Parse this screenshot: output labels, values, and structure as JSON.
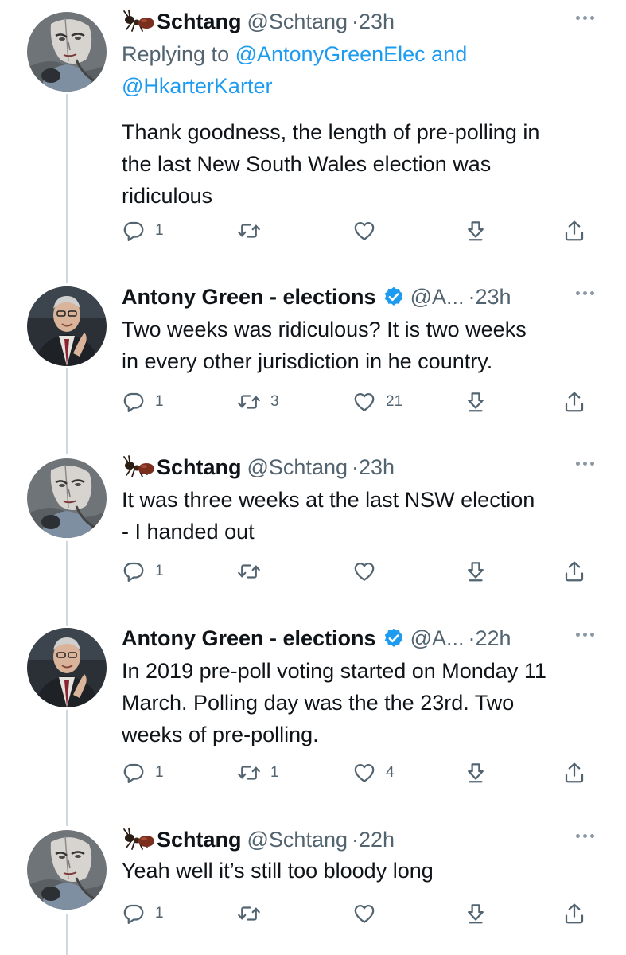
{
  "tweets": [
    {
      "author": "Schtang",
      "handle": "@Schtang",
      "time": "23h",
      "replying_prefix": "Replying to",
      "replying_user1": "@AntonyGreenElec",
      "replying_and": "and",
      "replying_user2": "@HkarterKarter",
      "text_lines": [
        "Thank goodness, the length of pre-polling in",
        "the last New South Wales election was",
        "ridiculous"
      ],
      "reply_count": "1",
      "retweet_count": "",
      "like_count": ""
    },
    {
      "author": "Antony Green - elections",
      "handle": "@A...",
      "time": "23h",
      "text_lines": [
        "Two weeks was ridiculous? It is two weeks",
        "in every other jurisdiction in he country."
      ],
      "reply_count": "1",
      "retweet_count": "3",
      "like_count": "21"
    },
    {
      "author": "Schtang",
      "handle": "@Schtang",
      "time": "23h",
      "text_lines": [
        "It was three weeks at the last NSW election",
        "- I handed out"
      ],
      "reply_count": "1",
      "retweet_count": "",
      "like_count": ""
    },
    {
      "author": "Antony Green - elections",
      "handle": "@A...",
      "time": "22h",
      "text_lines": [
        "In 2019 pre-poll voting started on Monday 11",
        "March. Polling day was the the 23rd. Two",
        "weeks of pre-polling."
      ],
      "reply_count": "1",
      "retweet_count": "1",
      "like_count": "4"
    },
    {
      "author": "Schtang",
      "handle": "@Schtang",
      "time": "22h",
      "text_lines": [
        "Yeah well it’s still too bloody long"
      ],
      "reply_count": "1",
      "retweet_count": "",
      "like_count": ""
    }
  ],
  "colors": {
    "link": "#1d9bf0",
    "verified": "#1d9bf0",
    "muted": "#536471",
    "thread_line": "#cfd9de"
  },
  "icons": [
    "reply-icon",
    "retweet-icon",
    "like-icon",
    "download-icon",
    "share-icon",
    "more-icon",
    "ant-emoji-icon",
    "verified-badge-icon"
  ]
}
